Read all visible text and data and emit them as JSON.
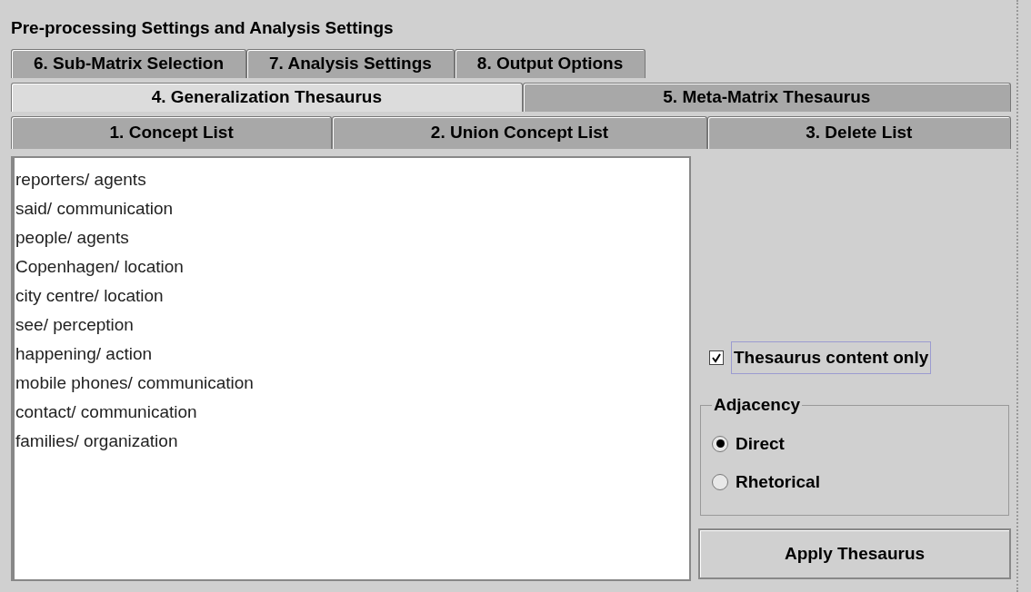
{
  "panel": {
    "title": "Pre-processing Settings and Analysis Settings"
  },
  "tab_rows": [
    [
      {
        "label": "6. Sub-Matrix Selection",
        "selected": false
      },
      {
        "label": "7. Analysis Settings",
        "selected": false
      },
      {
        "label": "8. Output Options",
        "selected": false
      }
    ],
    [
      {
        "label": "4. Generalization Thesaurus",
        "selected": true
      },
      {
        "label": "5. Meta-Matrix Thesaurus",
        "selected": false
      }
    ],
    [
      {
        "label": "1. Concept List",
        "selected": false
      },
      {
        "label": "2. Union Concept List",
        "selected": false
      },
      {
        "label": "3. Delete List",
        "selected": false
      }
    ]
  ],
  "list": [
    "reporters/ agents",
    "said/ communication",
    "people/ agents",
    "Copenhagen/ location",
    "city centre/ location",
    "see/ perception",
    "happening/ action",
    "mobile phones/ communication",
    "contact/ communication",
    "families/ organization"
  ],
  "checkbox": {
    "label": "Thesaurus content only",
    "checked": true,
    "focused": true
  },
  "adjacency": {
    "title": "Adjacency",
    "options": [
      {
        "label": "Direct",
        "selected": true
      },
      {
        "label": "Rhetorical",
        "selected": false
      }
    ]
  },
  "button": "Apply Thesaurus"
}
